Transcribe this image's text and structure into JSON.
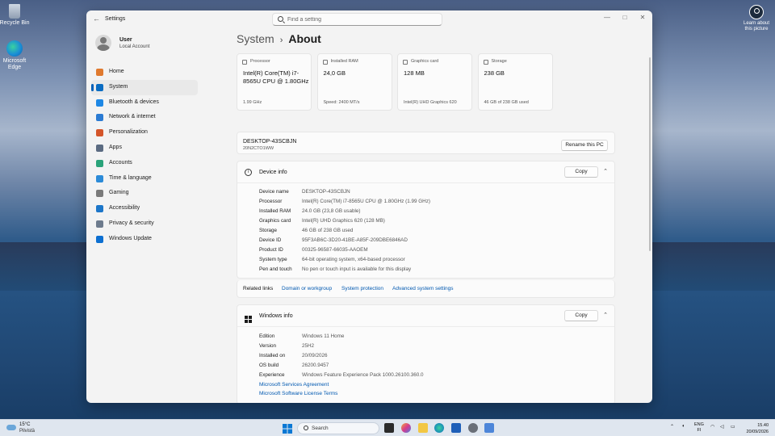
{
  "desktop": {
    "icons": [
      {
        "label": "Recycle Bin"
      },
      {
        "label": "Microsoft Edge"
      }
    ],
    "learn_label": "Learn about this picture"
  },
  "window": {
    "title": "Settings",
    "search_placeholder": "Find a setting",
    "controls": {
      "minimize": "—",
      "maximize": "□",
      "close": "✕"
    }
  },
  "user": {
    "name": "User",
    "account": "Local Account"
  },
  "sidebar": {
    "items": [
      {
        "label": "Home",
        "color": "#e07a2f"
      },
      {
        "label": "System",
        "color": "#0a6cc2"
      },
      {
        "label": "Bluetooth & devices",
        "color": "#1e88e5"
      },
      {
        "label": "Network & internet",
        "color": "#2b7bd3"
      },
      {
        "label": "Personalization",
        "color": "#d4552a"
      },
      {
        "label": "Apps",
        "color": "#5b6b82"
      },
      {
        "label": "Accounts",
        "color": "#2aa37a"
      },
      {
        "label": "Time & language",
        "color": "#2c8bd8"
      },
      {
        "label": "Gaming",
        "color": "#7a7a7a"
      },
      {
        "label": "Accessibility",
        "color": "#1c76c9"
      },
      {
        "label": "Privacy & security",
        "color": "#6d7b8d"
      },
      {
        "label": "Windows Update",
        "color": "#0c6fd1"
      }
    ]
  },
  "breadcrumb": {
    "parent": "System",
    "separator": "›",
    "current": "About"
  },
  "specs": [
    {
      "heading": "Processor",
      "value": "Intel(R) Core(TM) i7-8565U CPU @ 1.80GHz",
      "sub": "1.99 GHz"
    },
    {
      "heading": "Installed RAM",
      "value": "24,0 GB",
      "sub": "Speed: 2400 MT/s"
    },
    {
      "heading": "Graphics card",
      "value": "128 MB",
      "sub": "Intel(R) UHD Graphics 620"
    },
    {
      "heading": "Storage",
      "value": "238 GB",
      "sub": "46 GB of 238 GB used"
    }
  ],
  "device": {
    "name": "DESKTOP-43SCBJN",
    "model": "20N2CTO1WW",
    "rename_label": "Rename this PC"
  },
  "device_info": {
    "title": "Device info",
    "copy_label": "Copy",
    "rows": [
      {
        "label": "Device name",
        "value": "DESKTOP-43SCBJN"
      },
      {
        "label": "Processor",
        "value": "Intel(R) Core(TM) i7-8565U CPU @ 1.80GHz (1.99 GHz)"
      },
      {
        "label": "Installed RAM",
        "value": "24.0 GB (23,8 GB usable)"
      },
      {
        "label": "Graphics card",
        "value": "Intel(R) UHD Graphics 620 (128 MB)"
      },
      {
        "label": "Storage",
        "value": "46 GB of 238 GB used"
      },
      {
        "label": "Device ID",
        "value": "95F3AB6C-3D20-41BE-A85F-209DBE6846AD"
      },
      {
        "label": "Product ID",
        "value": "00325-96587-66035-AAOEM"
      },
      {
        "label": "System type",
        "value": "64-bit operating system, x64-based processor"
      },
      {
        "label": "Pen and touch",
        "value": "No pen or touch input is available for this display"
      }
    ]
  },
  "related": {
    "label": "Related links",
    "links": [
      "Domain or workgroup",
      "System protection",
      "Advanced system settings"
    ]
  },
  "windows_info": {
    "title": "Windows info",
    "copy_label": "Copy",
    "rows": [
      {
        "label": "Edition",
        "value": "Windows 11 Home"
      },
      {
        "label": "Version",
        "value": "25H2"
      },
      {
        "label": "Installed on",
        "value": "20/09/2026"
      },
      {
        "label": "OS build",
        "value": "26200.9457"
      },
      {
        "label": "Experience",
        "value": "Windows Feature Experience Pack 1000.26100.360.0"
      }
    ],
    "links": [
      "Microsoft Services Agreement",
      "Microsoft Software License Terms"
    ]
  },
  "taskbar": {
    "weather_temp": "15°C",
    "weather_desc": "Pilvistä",
    "search_label": "Search",
    "lang_top": "ENG",
    "lang_bottom": "FI",
    "time": "15.40",
    "date": "20/09/2026"
  }
}
